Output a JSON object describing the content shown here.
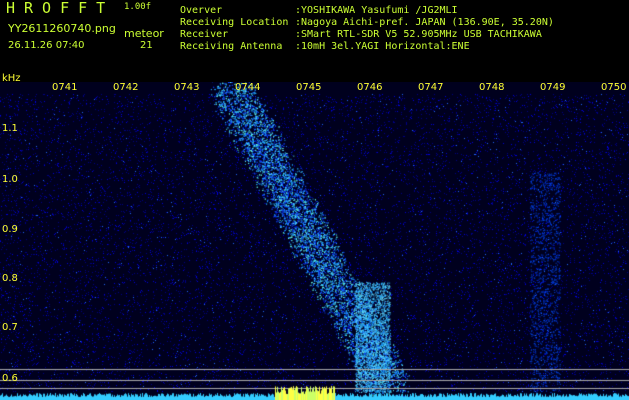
{
  "header": {
    "app_title": "HROFFT",
    "version": "1.00f",
    "file_name": "YY2611260740.png",
    "timestamp": "26.11.26 07:40",
    "meteor_label": "meteor",
    "meteor_count": "21"
  },
  "station_info": [
    {
      "key": "Overver",
      "value": ":YOSHIKAWA Yasufumi /JG2MLI"
    },
    {
      "key": "Receiving Location",
      "value": ":Nagoya Aichi-pref. JAPAN (136.90E, 35.20N)"
    },
    {
      "key": "Receiver",
      "value": ":SMart RTL-SDR V5 52.905MHz USB TACHIKAWA"
    },
    {
      "key": "Receiving Antenna",
      "value": ":10mH 3el.YAGI Horizontal:ENE"
    }
  ],
  "spectrogram": {
    "y_unit": "kHz",
    "y_ticks": [
      "1.1",
      "1.0",
      "0.9",
      "0.8",
      "0.7",
      "0.6"
    ],
    "x_ticks": [
      "0741",
      "0742",
      "0743",
      "0744",
      "0745",
      "0746",
      "0747",
      "0748",
      "0749",
      "0750"
    ],
    "colors": {
      "background": "#000033",
      "noise": "#0000cc",
      "signal": "#33ccff",
      "axis_text": "#ffff33",
      "header_text": "#ccff33"
    }
  }
}
